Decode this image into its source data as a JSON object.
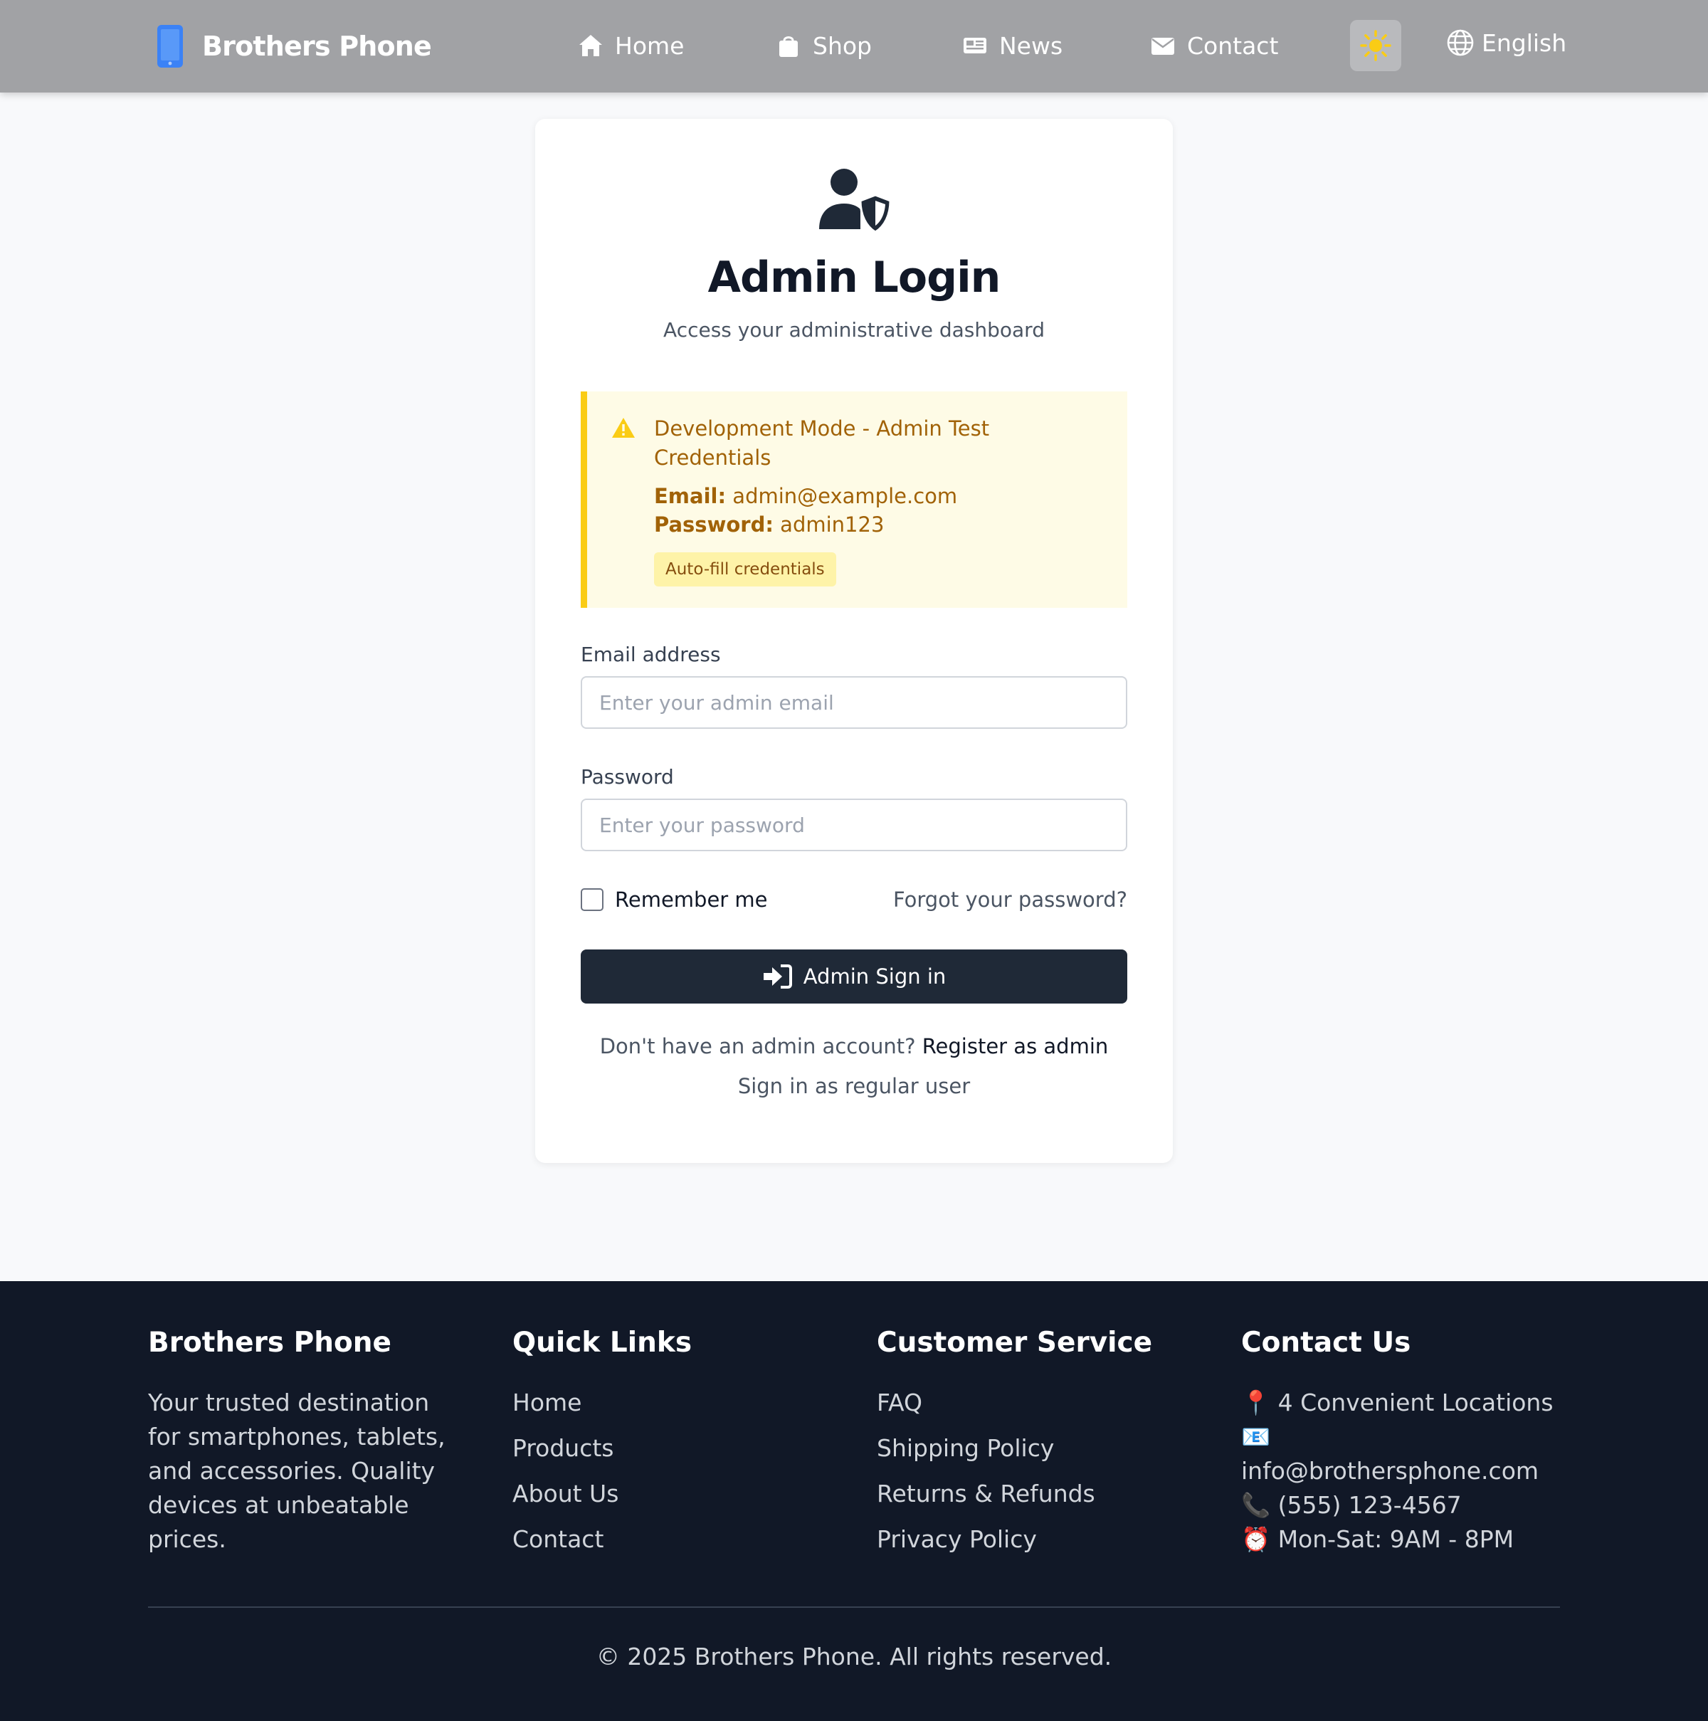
{
  "navbar": {
    "brand": "Brothers Phone",
    "links": [
      {
        "label": "Home",
        "icon": "home-icon"
      },
      {
        "label": "Shop",
        "icon": "shopping-bag-icon"
      },
      {
        "label": "News",
        "icon": "newspaper-icon"
      },
      {
        "label": "Contact",
        "icon": "envelope-icon"
      }
    ],
    "theme_icon": "sun-icon",
    "language": "English"
  },
  "login": {
    "icon": "user-shield-icon",
    "title": "Admin Login",
    "subtitle": "Access your administrative dashboard",
    "dev_notice": {
      "title": "Development Mode - Admin Test Credentials",
      "email_label": "Email:",
      "email_value": "admin@example.com",
      "password_label": "Password:",
      "password_value": "admin123",
      "autofill_label": "Auto-fill credentials"
    },
    "email": {
      "label": "Email address",
      "placeholder": "Enter your admin email",
      "value": ""
    },
    "password": {
      "label": "Password",
      "placeholder": "Enter your password",
      "value": ""
    },
    "remember_label": "Remember me",
    "forgot_label": "Forgot your password?",
    "submit_label": "Admin Sign in",
    "register_prompt": "Don't have an admin account?",
    "register_link": "Register as admin",
    "regular_user_link": "Sign in as regular user"
  },
  "footer": {
    "brand": {
      "title": "Brothers Phone",
      "description": "Your trusted destination for smartphones, tablets, and accessories. Quality devices at unbeatable prices."
    },
    "quick_links": {
      "title": "Quick Links",
      "items": [
        "Home",
        "Products",
        "About Us",
        "Contact"
      ]
    },
    "customer_service": {
      "title": "Customer Service",
      "items": [
        "FAQ",
        "Shipping Policy",
        "Returns & Refunds",
        "Privacy Policy"
      ]
    },
    "contact": {
      "title": "Contact Us",
      "locations": "📍 4 Convenient Locations",
      "email": "📧 info@brothersphone.com",
      "phone": "📞 (555) 123-4567",
      "hours": "⏰ Mon-Sat: 9AM - 8PM"
    },
    "copyright": "© 2025 Brothers Phone. All rights reserved."
  },
  "colors": {
    "navbar_bg": "#a1a2a5",
    "brand_icon": "#3b82f6",
    "primary_button": "#1f2937",
    "warning_accent": "#facc15",
    "warning_text": "#a16207",
    "footer_bg": "#111827"
  }
}
